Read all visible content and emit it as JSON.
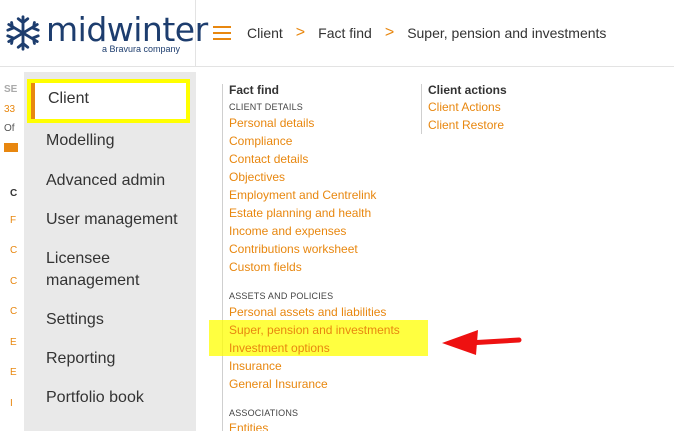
{
  "header": {
    "logo_text": "midwinter",
    "logo_sub": "a Bravura company",
    "breadcrumb": [
      "Client",
      "Fact find",
      "Super, pension and investments"
    ],
    "breadcrumb_sep": ">"
  },
  "background": {
    "line1": "SE",
    "line2": "33",
    "line3": "Of",
    "col_letters": [
      "C",
      "F",
      "C",
      "C",
      "C",
      "E",
      "E",
      "I"
    ]
  },
  "left_menu": {
    "items": [
      "Client",
      "Modelling",
      "Advanced admin",
      "User management",
      "Licensee management",
      "Settings",
      "Reporting",
      "Portfolio book"
    ]
  },
  "fact_find": {
    "title": "Fact find",
    "client_details_label": "CLIENT DETAILS",
    "client_details": [
      "Personal details",
      "Compliance",
      "Contact details",
      "Objectives",
      "Employment and Centrelink",
      "Estate planning and health",
      "Income and expenses",
      "Contributions worksheet",
      "Custom fields"
    ],
    "assets_label": "ASSETS AND POLICIES",
    "assets": [
      "Personal assets and liabilities",
      "Super, pension and investments",
      "Investment options",
      "Insurance",
      "General Insurance"
    ],
    "associations_label": "ASSOCIATIONS",
    "associations": [
      "Entities"
    ]
  },
  "client_actions": {
    "title": "Client actions",
    "links": [
      "Client Actions",
      "Client Restore"
    ]
  },
  "colors": {
    "accent": "#e8870f",
    "brand": "#1d3d6e",
    "highlight": "#ffff00",
    "arrow": "#ee1111"
  }
}
